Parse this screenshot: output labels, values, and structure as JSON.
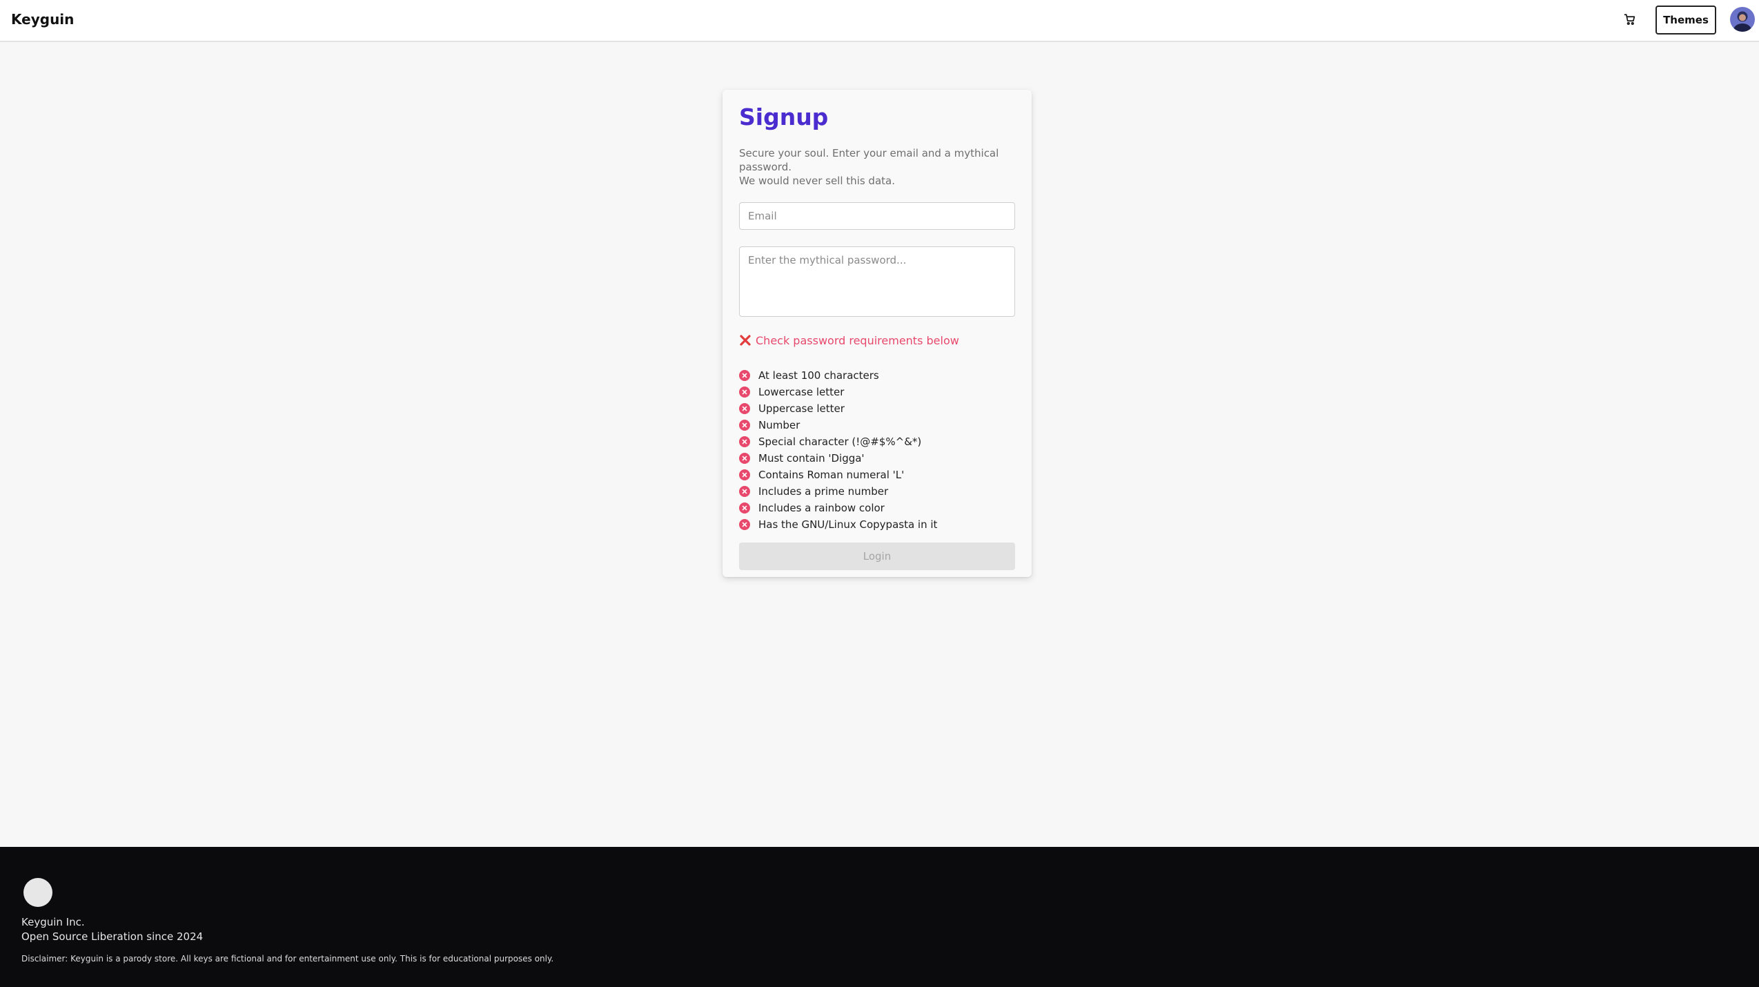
{
  "header": {
    "brand": "Keyguin",
    "cart_icon": "cart-icon",
    "themes_label": "Themes",
    "avatar_icon": "user-avatar"
  },
  "signup": {
    "title": "Signup",
    "subtitle_line1": "Secure your soul. Enter your email and a mythical password.",
    "subtitle_line2": "We would never sell this data.",
    "email_placeholder": "Email",
    "email_value": "",
    "password_placeholder": "Enter the mythical password...",
    "password_value": "",
    "error_message": "Check password requirements below",
    "requirements": [
      {
        "label": "At least 100 characters",
        "met": false
      },
      {
        "label": "Lowercase letter",
        "met": false
      },
      {
        "label": "Uppercase letter",
        "met": false
      },
      {
        "label": "Number",
        "met": false
      },
      {
        "label": "Special character (!@#$%^&*)",
        "met": false
      },
      {
        "label": "Must contain 'Digga'",
        "met": false
      },
      {
        "label": "Contains Roman numeral 'L'",
        "met": false
      },
      {
        "label": "Includes a prime number",
        "met": false
      },
      {
        "label": "Includes a rainbow color",
        "met": false
      },
      {
        "label": "Has the GNU/Linux Copypasta in it",
        "met": false
      }
    ],
    "login_label": "Login",
    "login_disabled": true
  },
  "footer": {
    "company": "Keyguin Inc.",
    "tagline": "Open Source Liberation since 2024",
    "disclaimer": "Disclaimer: Keyguin is a parody store. All keys are fictional and for entertainment use only. This is for educational purposes only."
  },
  "colors": {
    "accent": "#4a2ccf",
    "error": "#e8486b",
    "footer_bg": "#0b0b0d"
  }
}
